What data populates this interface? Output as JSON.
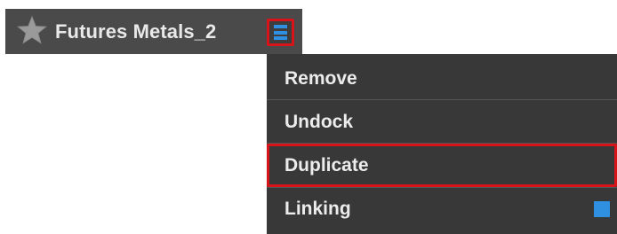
{
  "tab": {
    "title": "Futures Metals_2",
    "favorite_icon": "star-icon",
    "menu_icon": "hamburger-menu-icon"
  },
  "menu": {
    "items": [
      {
        "label": "Remove"
      },
      {
        "label": "Undock"
      },
      {
        "label": "Duplicate",
        "highlighted": true
      },
      {
        "label": "Linking",
        "swatch_color": "#2f8fe0"
      }
    ]
  },
  "colors": {
    "header_bg": "#4a4a4a",
    "menu_bg": "#383838",
    "highlight_border": "#d8141b",
    "accent_blue": "#2f8fe0",
    "text": "#ececec"
  }
}
